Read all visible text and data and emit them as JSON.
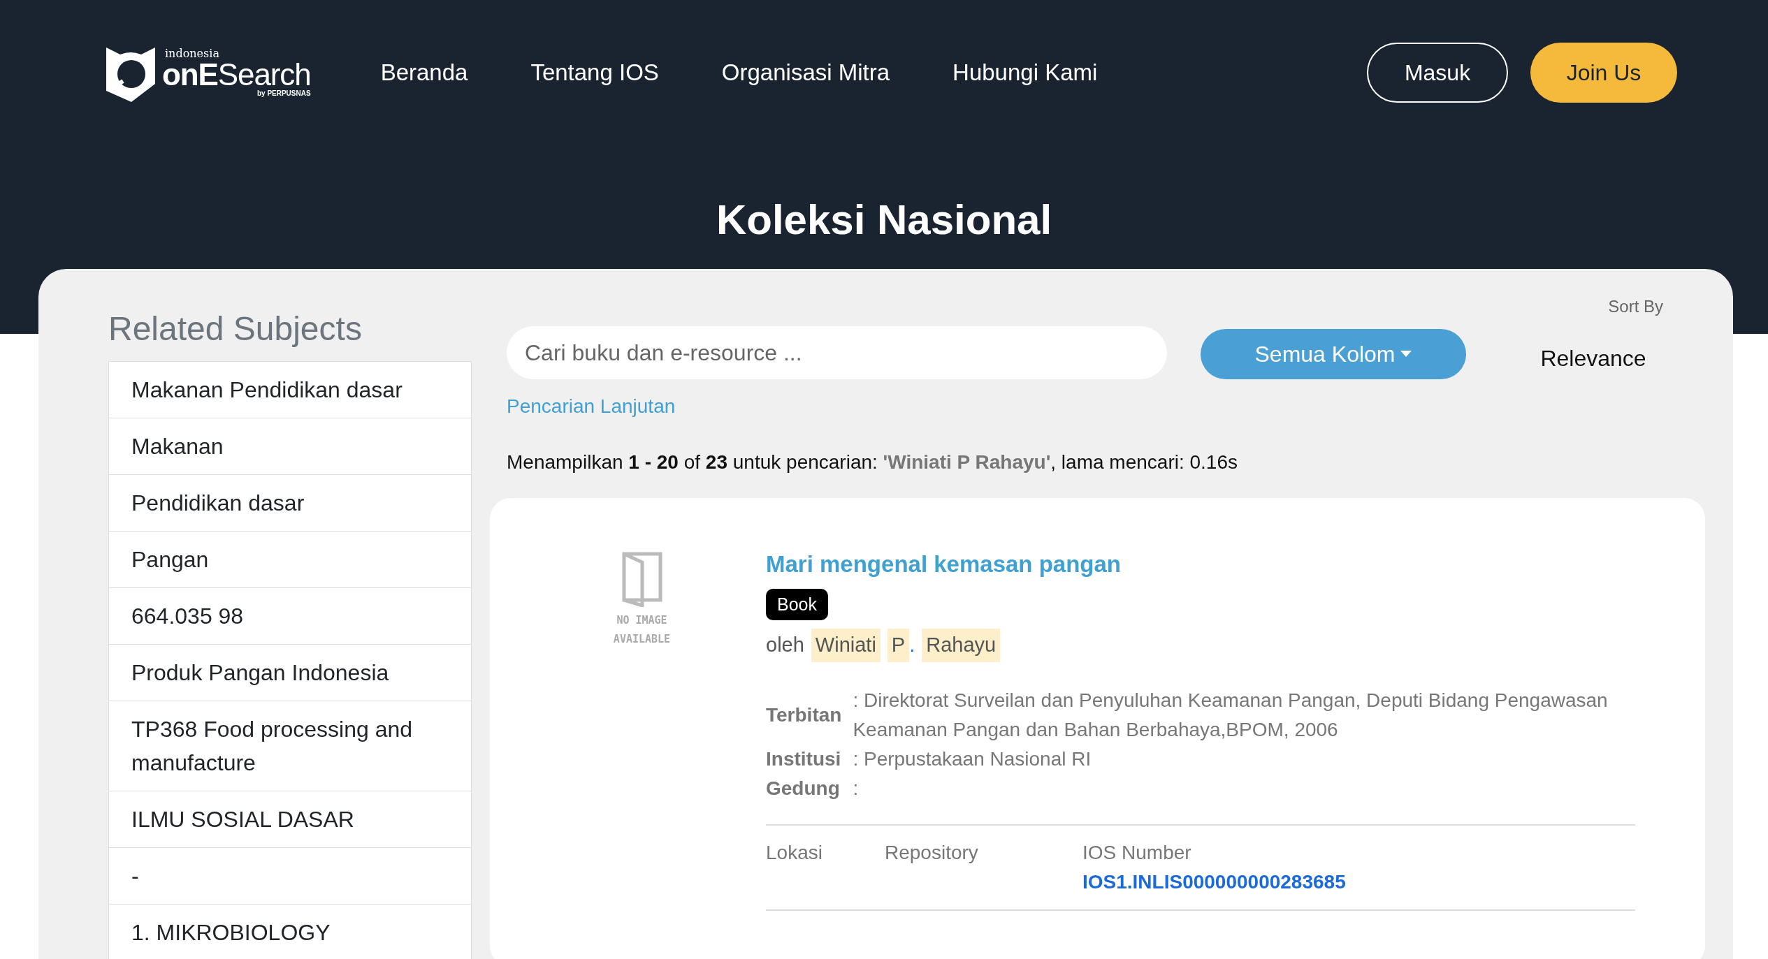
{
  "header": {
    "logo": {
      "top": "indonesia",
      "main": "**onE**Search",
      "by": "by PERPUSNAS"
    },
    "nav": [
      "Beranda",
      "Tentang IOS",
      "Organisasi Mitra",
      "Hubungi Kami"
    ],
    "login": "Masuk",
    "join": "Join Us",
    "title": "Koleksi Nasional"
  },
  "sidebar": {
    "title": "Related Subjects",
    "items": [
      "Makanan Pendidikan dasar",
      "Makanan",
      "Pendidikan dasar",
      "Pangan",
      "664.035 98",
      "Produk Pangan Indonesia",
      "TP368 Food processing and manufacture",
      "ILMU SOSIAL DASAR",
      "-",
      "1. MIKROBIOLOGY"
    ]
  },
  "search": {
    "placeholder": "Cari buku dan e-resource ...",
    "column_button": "Semua Kolom",
    "advanced": "Pencarian Lanjutan",
    "sort_label": "Sort By",
    "sort_value": "Relevance"
  },
  "summary": "Menampilkan **1 - 20** of **23** untuk pencarian: **'Winiati P Rahayu'**, lama mencari: 0.16s",
  "results": [
    {
      "cover": {
        "line1": "NO IMAGE",
        "line2": "AVAILABLE"
      },
      "title": "Mari mengenal kemasan pangan",
      "type": "Book",
      "by": "oleh",
      "authors": [
        {
          "text": "Winiati",
          "highlighted": true
        },
        {
          "text": "P",
          "highlighted": true,
          "suffix": "."
        },
        {
          "text": "Rahayu",
          "highlighted": true
        }
      ],
      "fields": [
        {
          "label": "Terbitan",
          "value": ": Direktorat Surveilan dan Penyuluhan Keamanan Pangan, Deputi Bidang Pengawasan Keamanan Pangan dan Bahan Berbahaya,BPOM, 2006"
        },
        {
          "label": "Institusi",
          "value": ": Perpustakaan Nasional RI"
        },
        {
          "label": "Gedung",
          "value": ":"
        }
      ],
      "holdings": {
        "columns": [
          "Lokasi",
          "Repository",
          "IOS Number"
        ],
        "ios_number": "IOS1.INLIS000000000283685"
      }
    }
  ]
}
